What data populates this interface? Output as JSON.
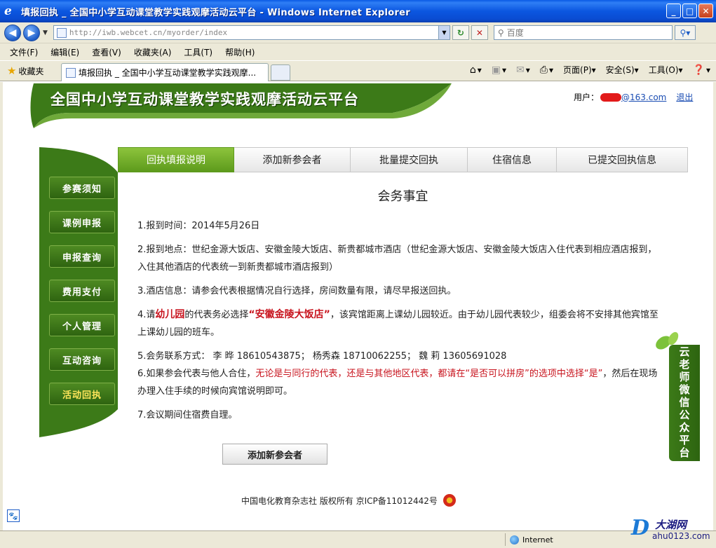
{
  "window": {
    "title": "填报回执 _ 全国中小学互动课堂教学实践观摩活动云平台 - Windows Internet Explorer",
    "minimize": "_",
    "maximize": "□",
    "close": "✕"
  },
  "address": {
    "url": "http://iwb.webcet.cn/myorder/index",
    "search_placeholder": "百度"
  },
  "menu": [
    "文件(F)",
    "编辑(E)",
    "查看(V)",
    "收藏夹(A)",
    "工具(T)",
    "帮助(H)"
  ],
  "favorites": {
    "label": "收藏夹",
    "tab_title": "填报回执 _ 全国中小学互动课堂教学实践观摩..."
  },
  "commands": {
    "page": "页面(P)",
    "safety": "安全(S)",
    "tools": "工具(O)"
  },
  "site": {
    "banner_title": "全国中小学互动课堂教学实践观摩活动云平台",
    "user_label": "用户：",
    "user_email_suffix": "@163.com",
    "logout": "退出"
  },
  "sidebar": {
    "items": [
      {
        "label": "参赛须知",
        "active": false
      },
      {
        "label": "课例申报",
        "active": false
      },
      {
        "label": "申报查询",
        "active": false
      },
      {
        "label": "费用支付",
        "active": false
      },
      {
        "label": "个人管理",
        "active": false
      },
      {
        "label": "互动咨询",
        "active": false
      },
      {
        "label": "活动回执",
        "active": true
      }
    ]
  },
  "tabs": [
    {
      "label": "回执填报说明",
      "active": true
    },
    {
      "label": "添加新参会者",
      "active": false
    },
    {
      "label": "批量提交回执",
      "active": false
    },
    {
      "label": "住宿信息",
      "active": false
    },
    {
      "label": "已提交回执信息",
      "active": false
    }
  ],
  "content": {
    "heading": "会务事宜",
    "item1": "1.报到时间：2014年5月26日",
    "item2": "2.报到地点：世纪金源大饭店、安徽金陵大饭店、新贵都城市酒店（世纪金源大饭店、安徽金陵大饭店入住代表到相应酒店报到，入住其他酒店的代表统一到新贵都城市酒店报到）",
    "item3": "3.酒店信息：请参会代表根据情况自行选择，房间数量有限，请尽早报送回执。",
    "item4_a": "4.请",
    "item4_b": "幼儿园",
    "item4_c": "的代表务必选择",
    "item4_d": "“安徽金陵大饭店”",
    "item4_e": "，该宾馆距离上课幼儿园较近。由于幼儿园代表较少，组委会将不安排其他宾馆至上课幼儿园的班车。",
    "item5": "5.会务联系方式：  李  晔  18610543875；  杨秀森  18710062255；  魏  莉  13605691028",
    "item6_a": "6.如果参会代表与他人合住，",
    "item6_b": "无论是与同行的代表，还是与其他地区代表，都请在“是否可以拼房”的选项中选择“是”",
    "item6_c": "，然后在现场办理入住手续的时候向宾馆说明即可。",
    "item7": "7.会议期间住宿费自理。",
    "add_button": "添加新参会者"
  },
  "footer": {
    "text": "中国电化教育杂志社  版权所有  京ICP备11012442号"
  },
  "wechat": {
    "label": "云老师微信公众平台"
  },
  "status": {
    "zone": "Internet"
  },
  "watermark": {
    "brand": "大湖网",
    "url": "ahu0123.com"
  },
  "colors": {
    "brand_green": "#3c7a18",
    "active_tab": "#6aa924",
    "highlight_red": "#c8141e",
    "ie_blue": "#0a4cd2"
  }
}
